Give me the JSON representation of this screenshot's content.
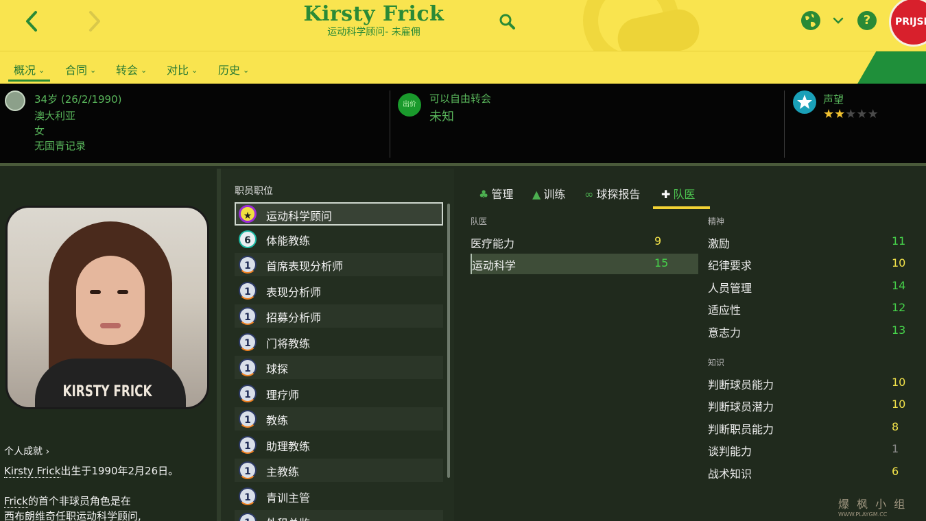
{
  "header": {
    "name": "Kirsty Frick",
    "subtitle": "运动科学顾问- 未雇佣",
    "badge_text": "PRIJSE"
  },
  "tabs": [
    {
      "label": "概况",
      "active": true
    },
    {
      "label": "合同",
      "active": false
    },
    {
      "label": "转会",
      "active": false
    },
    {
      "label": "对比",
      "active": false
    },
    {
      "label": "历史",
      "active": false
    }
  ],
  "info": {
    "age_dob": "34岁 (26/2/1990)",
    "nation": "澳大利亚",
    "gender": "女",
    "youth_record": "无国青记录",
    "transfer_icon_text": "出价",
    "transfer_status": "可以自由转会",
    "transfer_value": "未知",
    "reputation_label": "声望",
    "reputation_stars": 2,
    "reputation_max": 5
  },
  "portrait": {
    "caption": "KIRSTY FRICK"
  },
  "bio": {
    "achievements_label": "个人成就",
    "line1_name": "Kirsty Frick",
    "line1_rest": "出生于1990年2月26日。",
    "line2_name": "Frick",
    "line2_rest": "的首个非球员角色是在",
    "line3": "西布朗维奇任职运动科学顾问,"
  },
  "jobs": {
    "title": "职员职位",
    "items": [
      {
        "badge": "★",
        "label": "运动科学顾问"
      },
      {
        "badge": "6",
        "label": "体能教练"
      },
      {
        "badge": "1",
        "label": "首席表现分析师"
      },
      {
        "badge": "1",
        "label": "表现分析师"
      },
      {
        "badge": "1",
        "label": "招募分析师"
      },
      {
        "badge": "1",
        "label": "门将教练"
      },
      {
        "badge": "1",
        "label": "球探"
      },
      {
        "badge": "1",
        "label": "理疗师"
      },
      {
        "badge": "1",
        "label": "教练"
      },
      {
        "badge": "1",
        "label": "助理教练"
      },
      {
        "badge": "1",
        "label": "主教练"
      },
      {
        "badge": "1",
        "label": "青训主管"
      },
      {
        "badge": "1",
        "label": "外租总监"
      }
    ]
  },
  "attr_tabs": [
    {
      "label": "管理",
      "icon": "person-tree-icon"
    },
    {
      "label": "训练",
      "icon": "cone-icon"
    },
    {
      "label": "球探报告",
      "icon": "binoculars-icon"
    },
    {
      "label": "队医",
      "icon": "medkit-icon"
    }
  ],
  "medical": {
    "title": "队医",
    "items": [
      {
        "label": "医疗能力",
        "value": "9"
      },
      {
        "label": "运动科学",
        "value": "15"
      }
    ]
  },
  "mental": {
    "title": "精神",
    "items": [
      {
        "label": "激励",
        "value": "11"
      },
      {
        "label": "纪律要求",
        "value": "10"
      },
      {
        "label": "人员管理",
        "value": "14"
      },
      {
        "label": "适应性",
        "value": "12"
      },
      {
        "label": "意志力",
        "value": "13"
      }
    ]
  },
  "knowledge": {
    "title": "知识",
    "items": [
      {
        "label": "判断球员能力",
        "value": "10"
      },
      {
        "label": "判断球员潜力",
        "value": "10"
      },
      {
        "label": "判断职员能力",
        "value": "8"
      },
      {
        "label": "谈判能力",
        "value": "1"
      },
      {
        "label": "战术知识",
        "value": "6"
      }
    ]
  },
  "colors": {
    "value_yellow": "#f3e34a",
    "value_green": "#46d24a",
    "value_gray": "#8c8c8c",
    "accent_green": "#2a8a36",
    "topbar_yellow": "#f9e44f"
  },
  "watermark": {
    "line1": "爆 枫 小 组",
    "line2": "WWW.PLAYGM.CC"
  }
}
